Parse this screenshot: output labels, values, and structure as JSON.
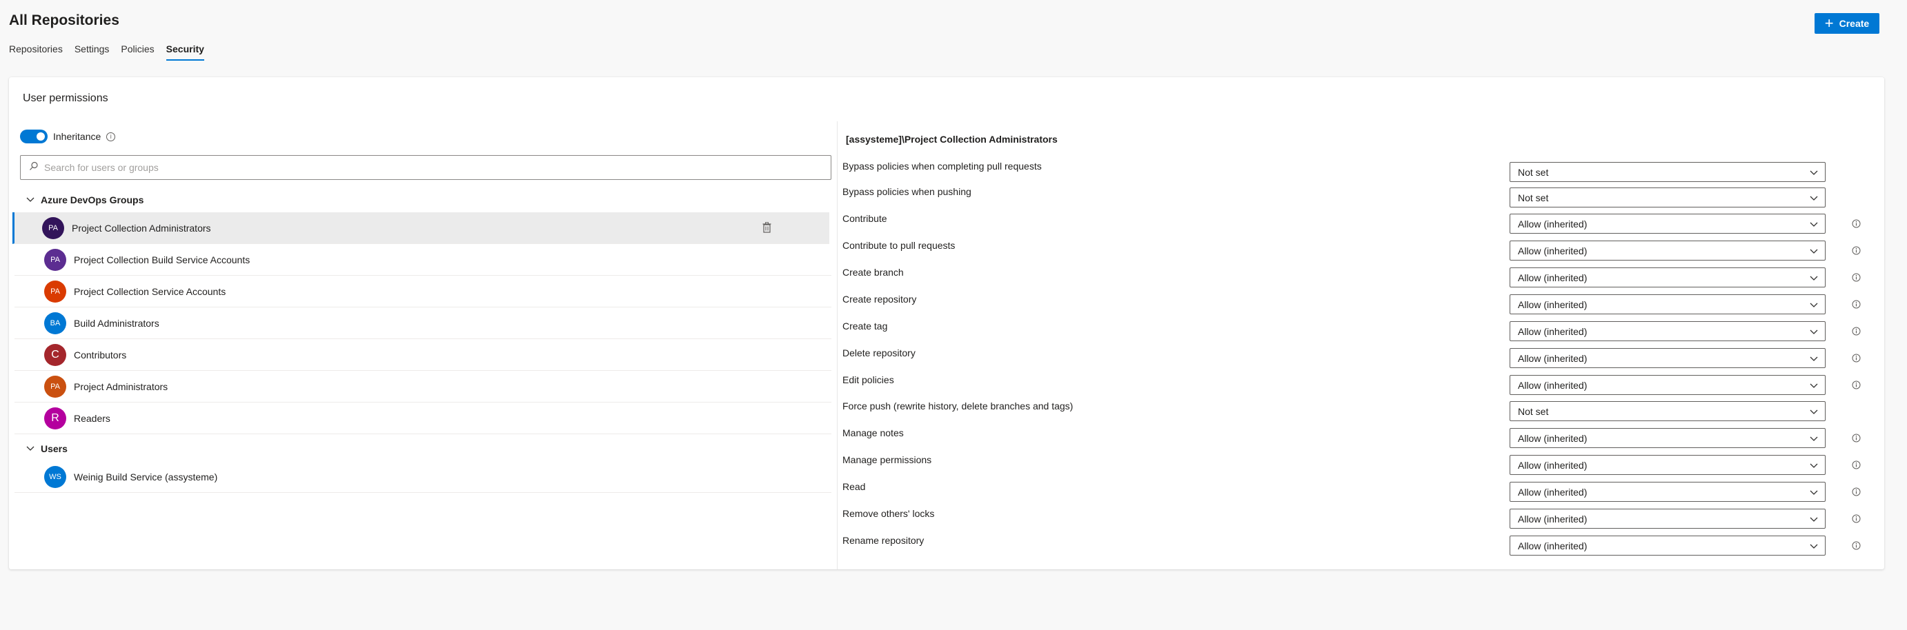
{
  "header": {
    "title": "All Repositories",
    "create_label": "Create"
  },
  "tabs": [
    {
      "label": "Repositories"
    },
    {
      "label": "Settings"
    },
    {
      "label": "Policies"
    },
    {
      "label": "Security"
    }
  ],
  "card": {
    "title": "User permissions"
  },
  "inheritance": {
    "label": "Inheritance",
    "enabled": true
  },
  "search": {
    "placeholder": "Search for users or groups",
    "value": ""
  },
  "groups": {
    "devops_label": "Azure DevOps Groups",
    "users_label": "Users"
  },
  "devops_items": [
    {
      "initials": "PA",
      "name": "Project Collection Administrators",
      "color": "#32145a"
    },
    {
      "initials": "PA",
      "name": "Project Collection Build Service Accounts",
      "color": "#5c2d91"
    },
    {
      "initials": "PA",
      "name": "Project Collection Service Accounts",
      "color": "#da3b01"
    },
    {
      "initials": "BA",
      "name": "Build Administrators",
      "color": "#0078d4"
    },
    {
      "initials": "C",
      "name": "Contributors",
      "color": "#a4262c"
    },
    {
      "initials": "PA",
      "name": "Project Administrators",
      "color": "#ca5010"
    },
    {
      "initials": "R",
      "name": "Readers",
      "color": "#b4009e"
    }
  ],
  "user_items": [
    {
      "initials": "WS",
      "name": "Weinig Build Service (assysteme)",
      "color": "#0078d4"
    }
  ],
  "permissions": {
    "heading": "[assysteme]\\Project Collection Administrators",
    "rows": [
      {
        "label": "Bypass policies when completing pull requests",
        "value": "Not set"
      },
      {
        "label": "Bypass policies when pushing",
        "value": "Not set"
      },
      {
        "label": "Contribute",
        "value": "Allow (inherited)"
      },
      {
        "label": "Contribute to pull requests",
        "value": "Allow (inherited)"
      },
      {
        "label": "Create branch",
        "value": "Allow (inherited)"
      },
      {
        "label": "Create repository",
        "value": "Allow (inherited)"
      },
      {
        "label": "Create tag",
        "value": "Allow (inherited)"
      },
      {
        "label": "Delete repository",
        "value": "Allow (inherited)"
      },
      {
        "label": "Edit policies",
        "value": "Allow (inherited)"
      },
      {
        "label": "Force push (rewrite history, delete branches and tags)",
        "value": "Not set"
      },
      {
        "label": "Manage notes",
        "value": "Allow (inherited)"
      },
      {
        "label": "Manage permissions",
        "value": "Allow (inherited)"
      },
      {
        "label": "Read",
        "value": "Allow (inherited)"
      },
      {
        "label": "Remove others' locks",
        "value": "Allow (inherited)"
      },
      {
        "label": "Rename repository",
        "value": "Allow (inherited)"
      }
    ]
  },
  "colors": {
    "accent": "#0078d4",
    "selected_row": "#ebebeb"
  }
}
